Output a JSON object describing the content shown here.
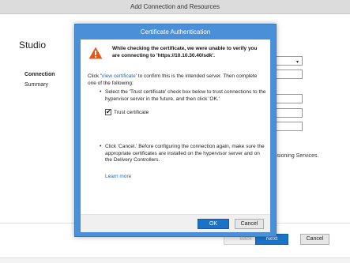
{
  "window": {
    "title": "Add Connection and Resources"
  },
  "sidebar": {
    "studio_label": "Studio",
    "items": [
      {
        "label": "Connection"
      },
      {
        "label": "Summary"
      }
    ]
  },
  "background": {
    "partial_text": "isioning Services."
  },
  "wizard_buttons": {
    "back": "Back",
    "next": "Next",
    "cancel": "Cancel"
  },
  "dialog": {
    "title": "Certificate Authentication",
    "warning_text": "While checking the certificate, we were unable to verify you are connecting to 'https://10.10.30.40/sdk'.",
    "intro_prefix": "Click '",
    "view_certificate_link": "View certificate",
    "intro_suffix": "' to confirm this is the intended server. Then complete one of the following:",
    "option1_text": "Select the 'Trust certificate' check box below to trust connections to the hypervisor server in the future, and then click 'OK.'",
    "trust_checkbox": {
      "label": "Trust certificate",
      "checked": true
    },
    "option2_text": "Click 'Cancel.' Before configuring the connection again, make sure the appropriate certificates are installed on the hypervisor server and on the Delivery Controllers.",
    "learn_more_link": "Learn more",
    "ok_button": "OK",
    "cancel_button": "Cancel"
  },
  "icons": {
    "warning": "warning-icon",
    "bullet": "•",
    "check": "✔",
    "caret": "▾"
  },
  "colors": {
    "dialog_frame": "#4a90d9",
    "primary_button": "#1a73c7",
    "link": "#1a67c0",
    "warning": "#e05a1e"
  }
}
